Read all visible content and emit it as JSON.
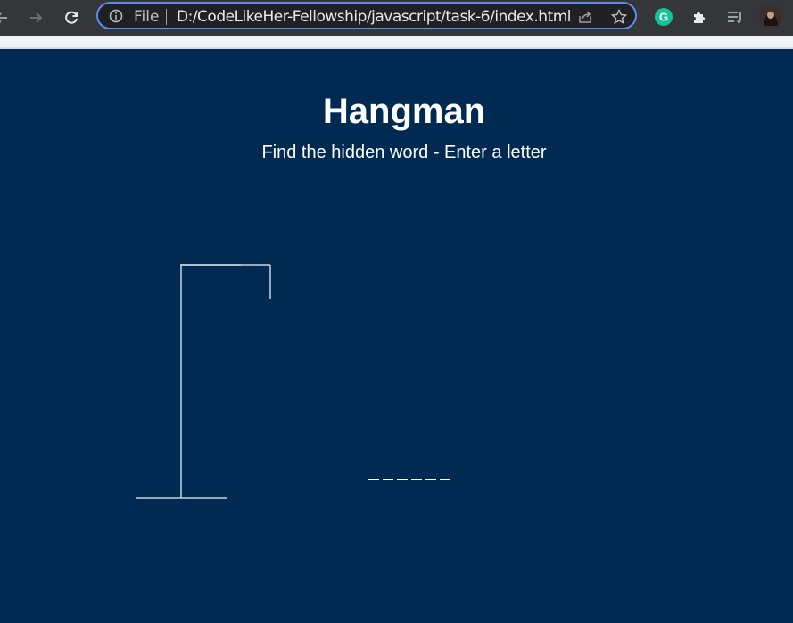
{
  "browser": {
    "file_label": "File",
    "url": "D:/CodeLikeHer-Fellowship/javascript/task-6/index.html"
  },
  "page": {
    "title": "Hangman",
    "subtitle": "Find the hidden word - Enter a letter",
    "word_blanks": 6
  },
  "colors": {
    "background": "#002a52",
    "text": "#ffffff",
    "gallows": "#c9d3df"
  }
}
